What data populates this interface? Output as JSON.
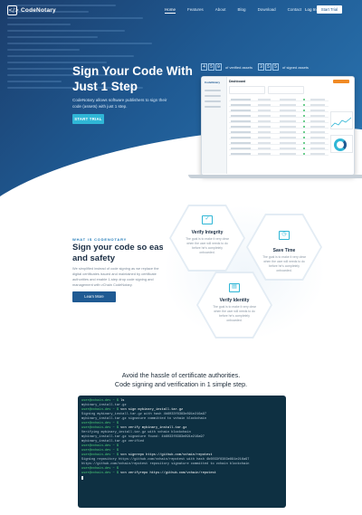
{
  "nav": {
    "logo_text": "CodeNotary",
    "links": [
      "Home",
      "Features",
      "About",
      "Blog",
      "Download",
      "Contact"
    ],
    "login": "Log In",
    "start_trial": "Start Trial"
  },
  "hero": {
    "title": "Sign Your Code With Just 1 Step",
    "subtitle": "CodeNotary allows software publishers to sign their code (assets) with just 1 step.",
    "button": "START TRIAL",
    "verified_digits": [
      "4",
      "5",
      "9"
    ],
    "verified_label": "of verified assets",
    "signed_digits": [
      "3",
      "5",
      "5"
    ],
    "signed_label": "of signed assets"
  },
  "dashboard": {
    "brand": "CodeNotary",
    "title": "Dashboard"
  },
  "about": {
    "eyebrow": "WHAT IS CODENOTARY",
    "title": "Sign your code so easy and safety",
    "text": "We simplified instead of code signing as we replace the digital certificates issued and maintained by certificate authorities and enable 1-step drop code signing and management with vChain CodeNotary.",
    "button": "Learn More"
  },
  "features": [
    {
      "title": "Verify Integrity",
      "text": "The goal is to make it very clear when the user will needs to do before he's completely onboarded."
    },
    {
      "title": "Save Time",
      "text": "The goal is to make it very clear when the user will needs to do before he's completely onboarded."
    },
    {
      "title": "Verify Identity",
      "text": "The goal is to make it very clear when the user will needs to do before he's completely onboarded."
    }
  ],
  "cli": {
    "heading_line1": "Avoid the hassle of certificate authorities.",
    "heading_line2": "Code signing and verification in 1 simple step.",
    "lines": [
      {
        "prompt": "user@vchain-dev ~ $",
        "cmd": " ls"
      },
      {
        "out": "mybinary_install.tar.gz"
      },
      {
        "prompt": "user@vchain-dev ~ $",
        "cmd": " vcn sign mybinary_install.tar.gz"
      },
      {
        "out": "Signing mybinary_install.tar.gz with hash 4b6033f8383e891e216a97"
      },
      {
        "out": "mybinary_install.tar.gz signature committed to vchain blockchain"
      },
      {
        "prompt": "user@vchain-dev ~ $",
        "cmd": ""
      },
      {
        "prompt": "user@vchain-dev ~ $",
        "cmd": " vcn verify mybinary_install.tar.gz"
      },
      {
        "out": "Verifying mybinary_install.tar.gz with vchain blockchain"
      },
      {
        "out": "mybinary_install.tar.gz signature found:  4b6033f8383e891e216a97"
      },
      {
        "out": "mybinary_install.tar.gz verified"
      },
      {
        "prompt": "user@vchain-dev ~ $",
        "cmd": ""
      },
      {
        "prompt": "user@vchain-dev ~ $",
        "cmd": ""
      },
      {
        "prompt": "user@vchain-dev ~ $",
        "cmd": " vcn signrepo  https://github.com/vchain/repotest"
      },
      {
        "out": "Signing repository https://github.com/vchain/repotest with hash 4b6033f8383e891e216a97"
      },
      {
        "out": "https://github.com/vchain/repotest repository signature committed to vchain blockchain"
      },
      {
        "prompt": "user@vchain-dev ~ $",
        "cmd": ""
      },
      {
        "prompt": "user@vchain-dev ~ $",
        "cmd": " vcn verifyrepo  https://github.com/vchain/repotest"
      }
    ]
  },
  "colors": {
    "hero_dark": "#1b3d6b",
    "hero_light": "#2c79b6",
    "accent": "#2fb6d6",
    "primary_button": "#1f5a93",
    "terminal_bg": "#0e3042",
    "prompt_green": "#4fd07a"
  }
}
